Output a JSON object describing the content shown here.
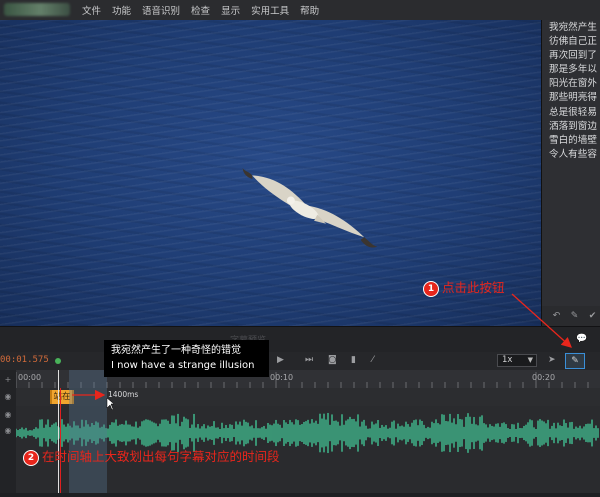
{
  "menu": [
    "文件",
    "功能",
    "语音识别",
    "检查",
    "显示",
    "实用工具",
    "帮助"
  ],
  "text_panel": {
    "lines": [
      "我宛然产生",
      "彷佛自己正",
      "再次回到了",
      "那是多年以",
      "阳光在窗外",
      "那些明亮得",
      "总是很轻易",
      "洒落到窗边",
      "雪白的墙壁",
      "令人有些容"
    ]
  },
  "icons": {
    "undo": "undo-icon",
    "pen": "pen-icon",
    "check": "check-icon",
    "comment": "comment-icon",
    "edit": "edit-icon",
    "eye": "eye-icon"
  },
  "below_video_label": "字幕预览",
  "transport": {
    "timecode": "00:01.575",
    "zoom": "1x"
  },
  "ruler": {
    "labels": [
      "00:00",
      "00:10",
      "00:20"
    ]
  },
  "timeline": {
    "subtitle_block_text": "站在",
    "duration_label": "1400ms"
  },
  "tooltip": {
    "zh": "我宛然产生了一种奇怪的错觉",
    "en": "I now have a strange illusion"
  },
  "annotations": {
    "step1_num": "1",
    "step1_text": "点击此按钮",
    "step2_num": "2",
    "step2_text": "在时间轴上大致划出每句字幕对应的时间段"
  },
  "colors": {
    "accent_red": "#e8261c",
    "waveform": "#3fae86",
    "subtitle_block": "#f1a52e",
    "timecode": "#d06a3a"
  }
}
